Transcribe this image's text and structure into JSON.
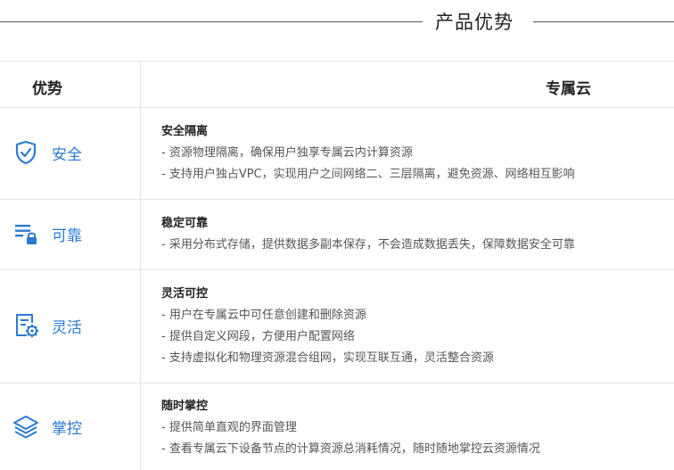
{
  "section_title": "产品优势",
  "table": {
    "header_left": "优势",
    "header_right": "专属云"
  },
  "rows": [
    {
      "icon": "shield-check-icon",
      "label": "安全",
      "title": "安全隔离",
      "lines": [
        "- 资源物理隔离，确保用户独享专属云内计算资源",
        "- 支持用户独占VPC，实现用户之间网络二、三层隔离，避免资源、网络相互影响"
      ]
    },
    {
      "icon": "list-lock-icon",
      "label": "可靠",
      "title": "稳定可靠",
      "lines": [
        "- 采用分布式存储，提供数据多副本保存，不会造成数据丢失，保障数据安全可靠"
      ]
    },
    {
      "icon": "document-gear-icon",
      "label": "灵活",
      "title": "灵活可控",
      "lines": [
        "- 用户在专属云中可任意创建和删除资源",
        "- 提供自定义网段，方便用户配置网络",
        "- 支持虚拟化和物理资源混合组网，实现互联互通，灵活整合资源"
      ]
    },
    {
      "icon": "layers-icon",
      "label": "掌控",
      "title": "随时掌控",
      "lines": [
        "- 提供简单直观的界面管理",
        "- 查看专属云下设备节点的计算资源总消耗情况，随时随地掌控云资源情况"
      ]
    }
  ],
  "colors": {
    "accent": "#2b7bd0",
    "border": "#e3e3e3",
    "text": "#333333"
  }
}
